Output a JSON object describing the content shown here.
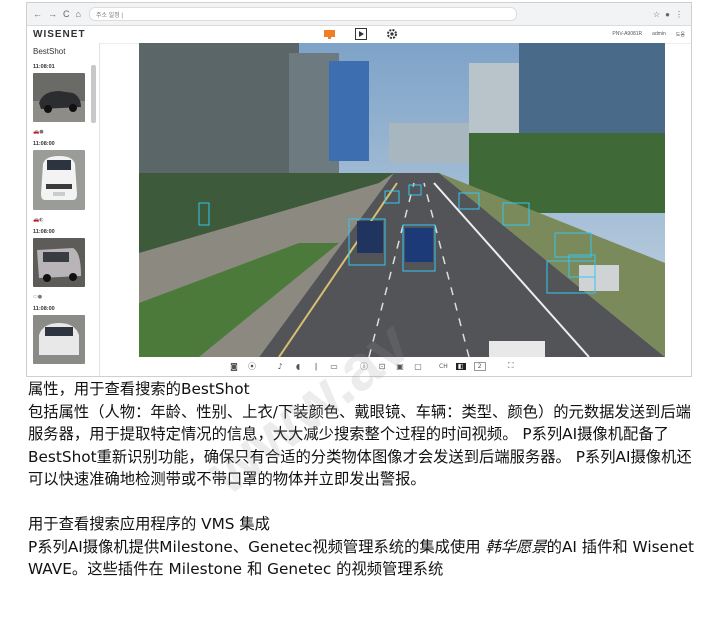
{
  "browser": {
    "url": "주소 일정 |",
    "nav_icons": [
      "←",
      "→",
      "C",
      "⌂"
    ]
  },
  "app": {
    "logo": "WISENET",
    "device_name": "PNV-A9081R",
    "user": "admin",
    "help": "도움"
  },
  "sidebar": {
    "title": "BestShot",
    "cards": [
      {
        "time": "11:08:01",
        "meta": "🚗●"
      },
      {
        "time": "11:08:00",
        "meta": "🚗◐"
      },
      {
        "time": "11:08:00",
        "meta": "▭●"
      },
      {
        "time": "11:08:00",
        "meta": ""
      }
    ]
  },
  "toolbar": {
    "channel_label": "CH",
    "channel_value": "2"
  },
  "caption": {
    "line1": "属性，用于查看搜索的BestShot",
    "para1": "包括属性（人物：年龄、性别、上衣/下装颜色、戴眼镜、车辆：类型、颜色）的元数据发送到后端服务器，用于提取特定情况的信息，大大减少搜索整个过程的时间视频。 P系列AI摄像机配备了BestShot重新识别功能，确保只有合适的分类物体图像才会发送到后端服务器。 P系列AI摄像机还可以快速准确地检测带或不带口罩的物体并立即发出警报。",
    "line2": "用于查看搜索应用程序的 VMS 集成",
    "para2_a": "P系列AI摄像机提供Milestone、Genetec视频管理系统的集成使用 ",
    "para2_em": "韩华愿景",
    "para2_b": "的AI 插件和 Wisenet WAVE。这些插件在 Milestone 和 Genetec 的视频管理系统"
  },
  "watermark": "www.av"
}
